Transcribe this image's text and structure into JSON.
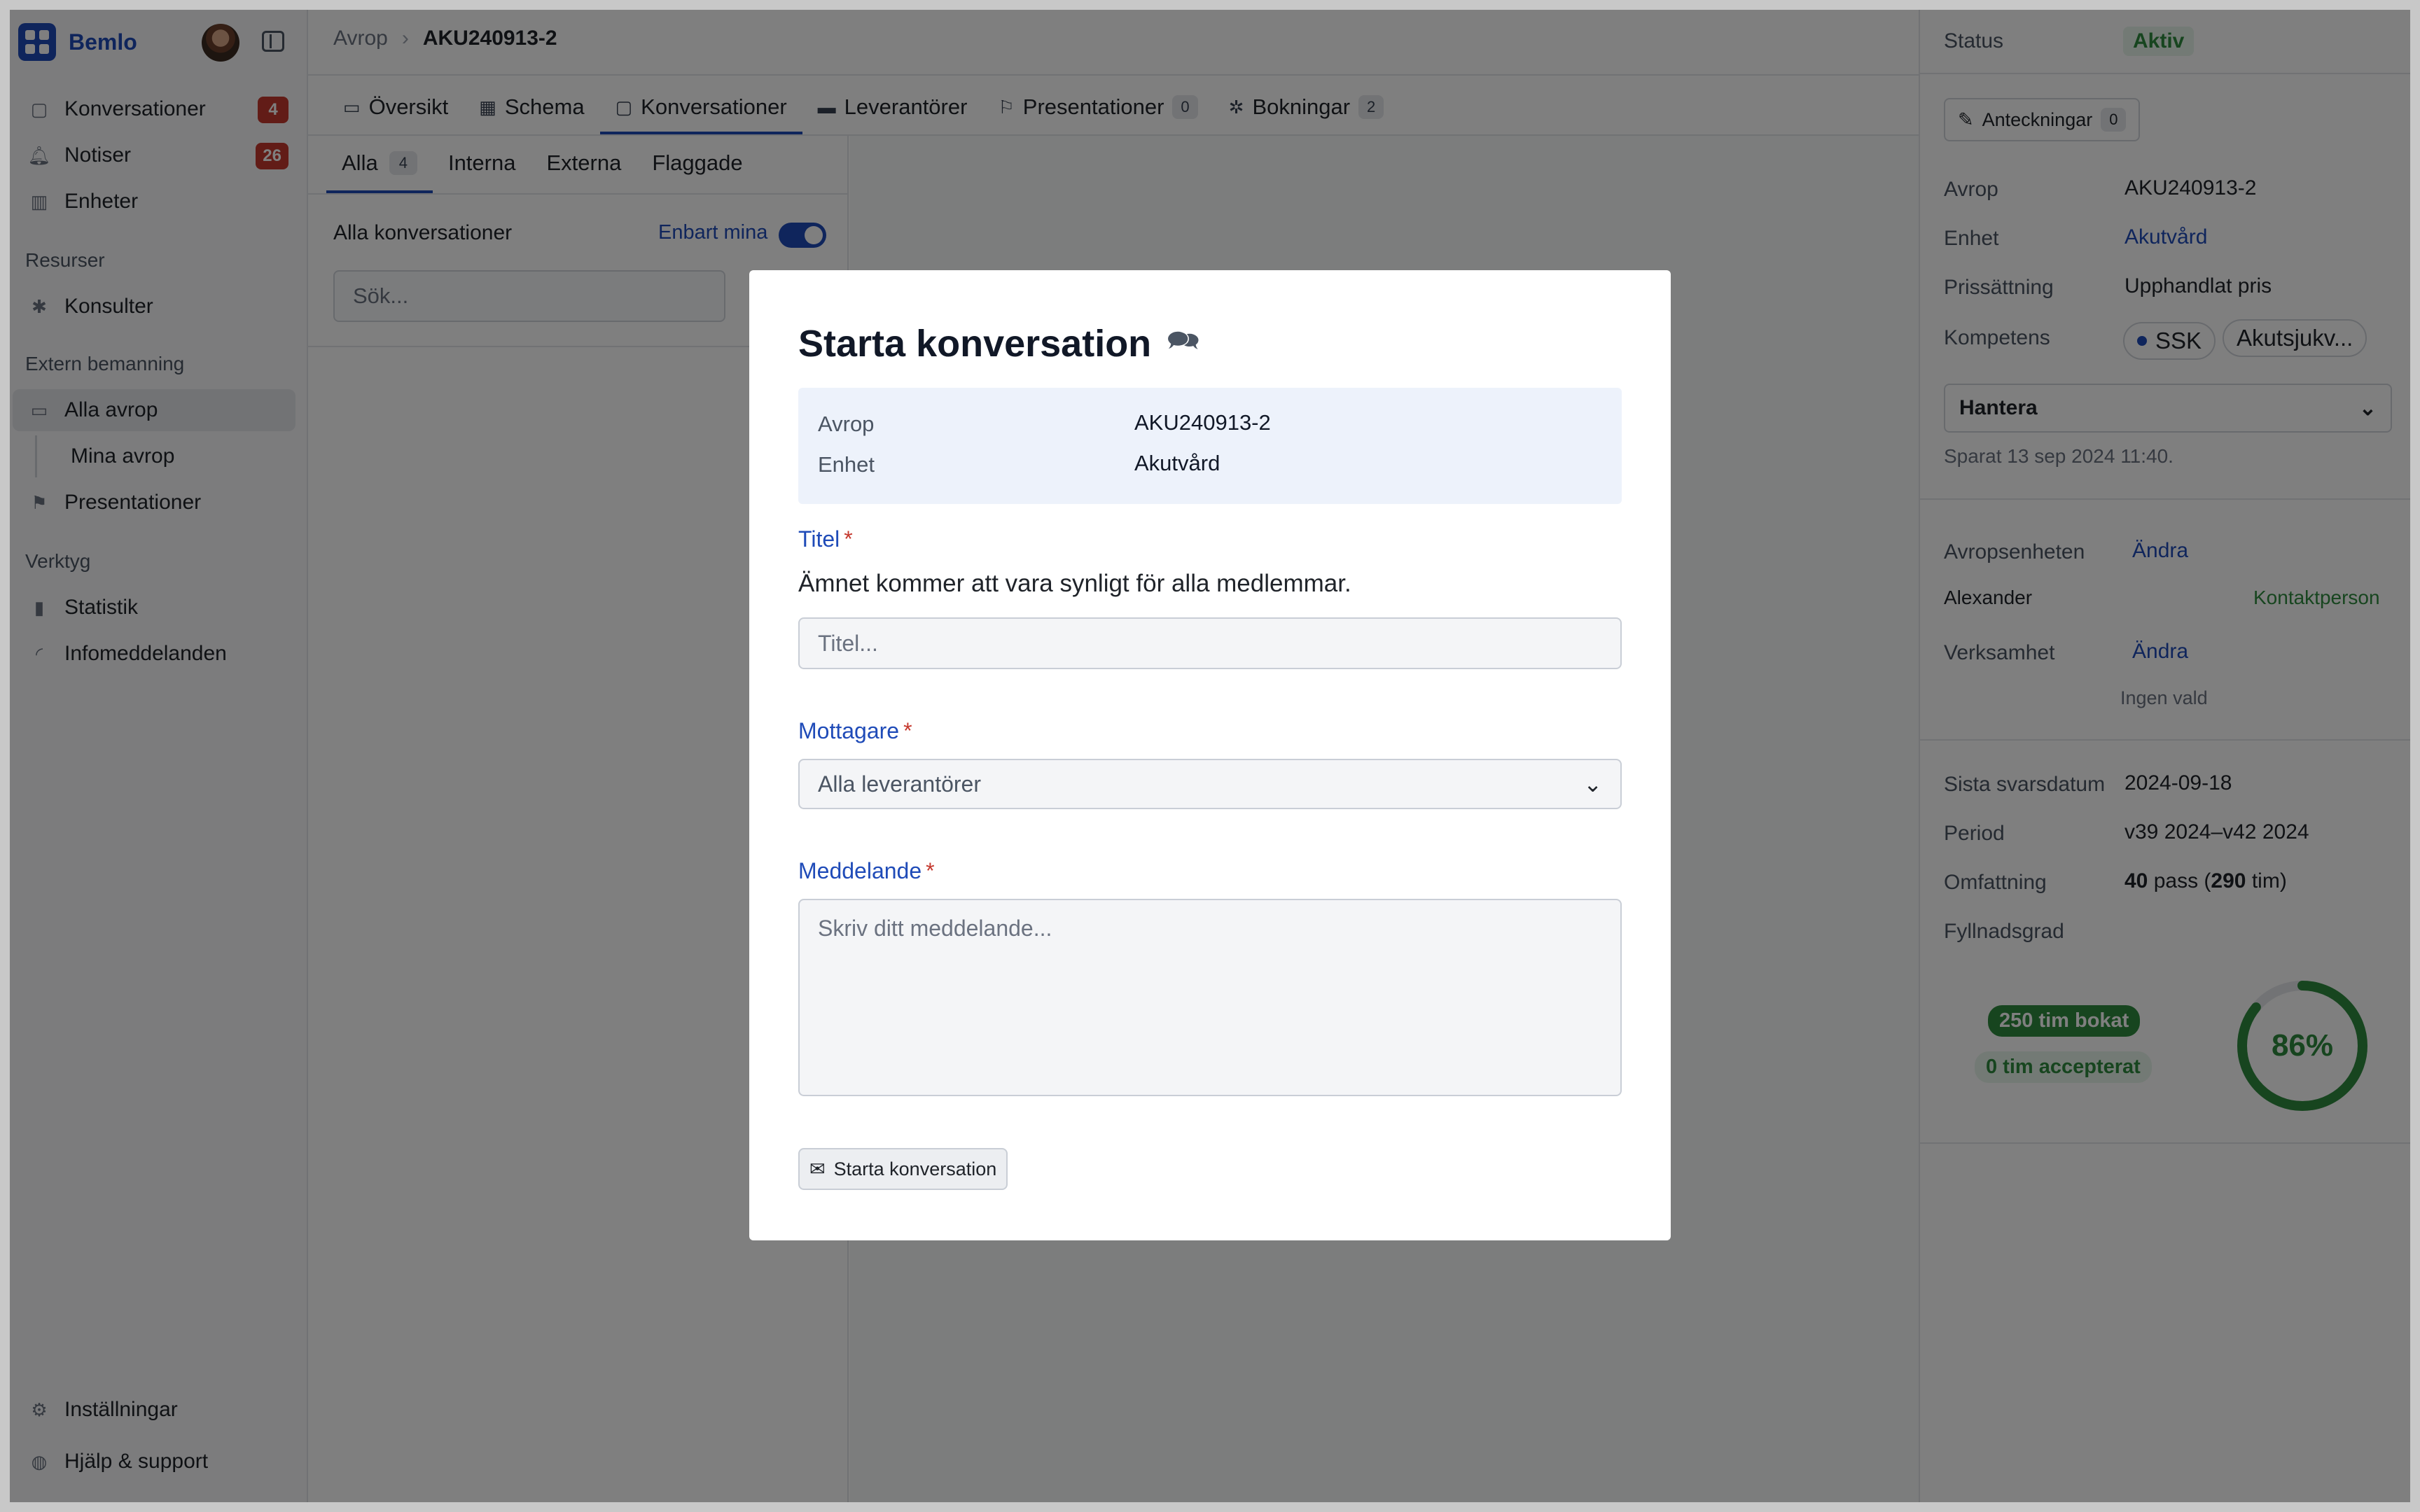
{
  "app": {
    "brand": "Bemlo"
  },
  "sidebar": {
    "items": [
      {
        "label": "Konversationer",
        "badge": "4",
        "icon": "inbox-icon"
      },
      {
        "label": "Notiser",
        "badge": "26",
        "icon": "bell-icon"
      },
      {
        "label": "Enheter",
        "icon": "building-icon"
      }
    ],
    "resources_heading": "Resurser",
    "consultants": "Konsulter",
    "staffing_heading": "Extern bemanning",
    "all_requests": "Alla avrop",
    "my_requests": "Mina avrop",
    "presentations": "Presentationer",
    "tools_heading": "Verktyg",
    "statistics": "Statistik",
    "info_messages": "Infomeddelanden",
    "settings": "Inställningar",
    "help": "Hjälp & support"
  },
  "breadcrumb": {
    "parent": "Avrop",
    "current": "AKU240913-2"
  },
  "tabs": [
    {
      "label": "Översikt"
    },
    {
      "label": "Schema"
    },
    {
      "label": "Konversationer"
    },
    {
      "label": "Leverantörer"
    },
    {
      "label": "Presentationer",
      "count": "0"
    },
    {
      "label": "Bokningar",
      "count": "2"
    }
  ],
  "conversations": {
    "subtabs": [
      {
        "label": "Alla",
        "count": "4"
      },
      {
        "label": "Interna"
      },
      {
        "label": "Externa"
      },
      {
        "label": "Flaggade"
      }
    ],
    "list_title": "Alla konversationer",
    "only_mine": "Enbart mina",
    "search_placeholder": "Sök..."
  },
  "details": {
    "status_label": "Status",
    "status_value": "Aktiv",
    "notes_label": "Anteckningar",
    "notes_count": "0",
    "avrop_label": "Avrop",
    "avrop_value": "AKU240913-2",
    "unit_label": "Enhet",
    "unit_value": "Akutvård",
    "pricing_label": "Prissättning",
    "pricing_value": "Upphandlat pris",
    "competence_label": "Kompetens",
    "competence_chips": [
      "SSK",
      "Akutsjukv..."
    ],
    "manage_label": "Hantera",
    "saved_text": "Sparat 13 sep 2024 11:40.",
    "request_unit_label": "Avropsenheten",
    "change_label": "Ändra",
    "contact_name": "Alexander",
    "contact_role": "Kontaktperson",
    "business_label": "Verksamhet",
    "business_change": "Ändra",
    "business_value": "Ingen vald",
    "deadline_label": "Sista svarsdatum",
    "deadline_value": "2024-09-18",
    "period_label": "Period",
    "period_value": "v39 2024–v42 2024",
    "scope_label": "Omfattning",
    "scope_shifts": "40",
    "scope_shifts_unit": "pass (",
    "scope_hours": "290",
    "scope_hours_unit": "tim)",
    "fill_label": "Fyllnadsgrad",
    "booked_pill": "250 tim bokat",
    "accepted_pill": "0 tim accepterat",
    "fill_percent_text": "86%",
    "fill_fraction": 0.86,
    "accent_green": "#2e8b3e"
  },
  "modal": {
    "title": "Starta konversation",
    "title_icon": "chat-bubbles-icon",
    "info_avrop_label": "Avrop",
    "info_avrop_value": "AKU240913-2",
    "info_unit_label": "Enhet",
    "info_unit_value": "Akutvård",
    "title_field_label": "Titel",
    "required_mark": "*",
    "title_help": "Ämnet kommer att vara synligt för alla medlemmar.",
    "title_placeholder": "Titel...",
    "recipient_label": "Mottagare",
    "recipient_value": "Alla leverantörer",
    "message_label": "Meddelande",
    "message_placeholder": "Skriv ditt meddelande...",
    "submit_label": "Starta konversation"
  },
  "colors": {
    "brand": "#1f4bb8",
    "danger": "#c5392e",
    "success": "#2e8b3e"
  }
}
